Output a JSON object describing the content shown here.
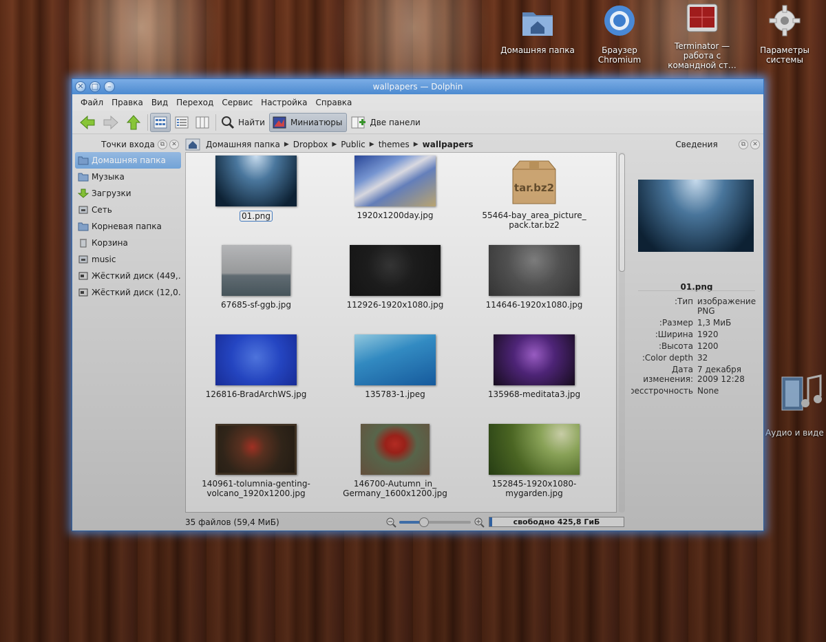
{
  "desktop": {
    "icons": [
      {
        "label": "Домашняя папка",
        "icon": "home-folder-icon"
      },
      {
        "label": "Браузер Chromium",
        "icon": "chromium-icon"
      },
      {
        "label": "Terminator — работа с командной ст…",
        "icon": "terminal-icon"
      },
      {
        "label": "Параметры системы",
        "icon": "gear-icon"
      },
      {
        "label": "Аудио и виде",
        "icon": "media-icon"
      }
    ]
  },
  "window": {
    "title": "wallpapers — Dolphin",
    "accent": "#4f8fd8"
  },
  "menu": [
    "Файл",
    "Правка",
    "Вид",
    "Переход",
    "Сервис",
    "Настройка",
    "Справка"
  ],
  "toolbar": {
    "find_label": "Найти",
    "previews_label": "Миниатюры",
    "split_label": "Две панели"
  },
  "places": {
    "title": "Точки входа",
    "items": [
      {
        "label": "Домашняя папка",
        "icon": "home-folder-icon",
        "selected": true
      },
      {
        "label": "Музыка",
        "icon": "music-folder-icon"
      },
      {
        "label": "Загрузки",
        "icon": "download-icon"
      },
      {
        "label": "Сеть",
        "icon": "network-icon"
      },
      {
        "label": "Корневая папка",
        "icon": "folder-icon"
      },
      {
        "label": "Корзина",
        "icon": "trash-icon"
      },
      {
        "label": "music",
        "icon": "drive-icon"
      },
      {
        "label": "Жёсткий диск (449,…",
        "icon": "harddisk-icon"
      },
      {
        "label": "Жёсткий диск (12,0…",
        "icon": "harddisk-icon"
      }
    ]
  },
  "breadcrumb": [
    "Домашняя папка",
    "Dropbox",
    "Public",
    "themes",
    "wallpapers"
  ],
  "files": [
    {
      "name": "01.png",
      "selected": true
    },
    {
      "name": "1920x1200day.jpg"
    },
    {
      "name": "55464-bay_area_picture_pack.tar.bz2",
      "line1": "55464-bay_area_picture_",
      "line2": "pack.tar.bz2",
      "badge": "tar.bz2"
    },
    {
      "name": "67685-sf-ggb.jpg"
    },
    {
      "name": "112926-1920x1080.jpg"
    },
    {
      "name": "114646-1920x1080.jpg"
    },
    {
      "name": "126816-BradArchWS.jpg"
    },
    {
      "name": "135783-1.jpeg"
    },
    {
      "name": "135968-meditata3.jpg"
    },
    {
      "name": "140961-tolumnia-genting-volcano_1920x1200.jpg",
      "line1": "140961-tolumnia-genting-",
      "line2": "volcano_1920x1200.jpg"
    },
    {
      "name": "146700-Autumn_in_Germany_1600x1200.jpg",
      "line1": "146700-Autumn_in_",
      "line2": "Germany_1600x1200.jpg"
    },
    {
      "name": "152845-1920x1080-mygarden.jpg",
      "line1": "152845-1920x1080-",
      "line2": "mygarden.jpg"
    }
  ],
  "info": {
    "title": "Сведения",
    "filename": "01.png",
    "rows": [
      {
        "key": "Тип:",
        "value": "изображение PNG"
      },
      {
        "key": "Размер:",
        "value": "1,3 МиБ"
      },
      {
        "key": "Ширина:",
        "value": "1920"
      },
      {
        "key": "Высота:",
        "value": "1200"
      },
      {
        "key": "Color depth:",
        "value": "32"
      },
      {
        "key": "Дата изменения:",
        "value": "7 декабря 2009 12:28"
      },
      {
        "key": "Чересстрочность:",
        "value": "None"
      }
    ]
  },
  "status": {
    "count": "35 файлов (59,4 МиБ)",
    "free": "свободно 425,8 ГиБ",
    "zoom_fraction": 0.35,
    "used_fraction": 0.02
  }
}
